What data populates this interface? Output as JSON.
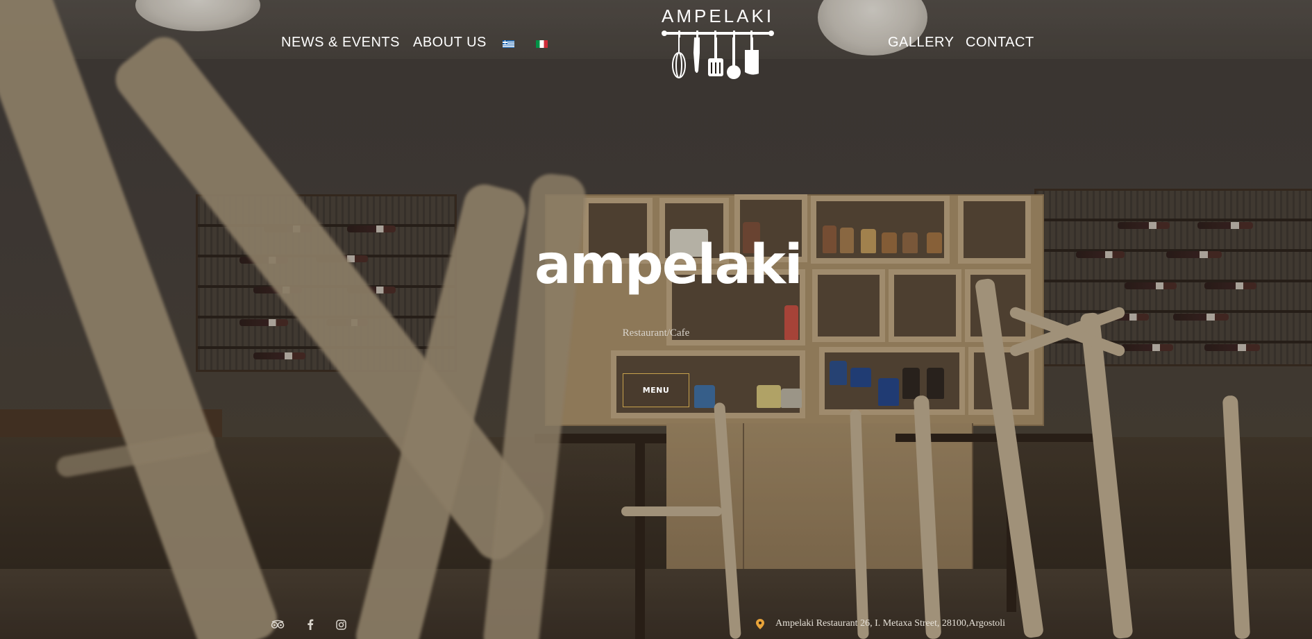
{
  "header": {
    "nav_left": [
      {
        "label": "NEWS & EVENTS"
      },
      {
        "label": "ABOUT US"
      }
    ],
    "languages": [
      {
        "code": "el",
        "icon": "greek-flag-icon"
      },
      {
        "code": "it",
        "icon": "italian-flag-icon"
      }
    ],
    "logo": {
      "text": "AMPELAKI",
      "icon": "kitchen-utensils-icon"
    },
    "nav_right": [
      {
        "label": "GALLERY"
      },
      {
        "label": "CONTACT"
      }
    ]
  },
  "hero": {
    "title": "ampelaki",
    "subtitle": "Restaurant/Cafe",
    "menu_button": "MENU"
  },
  "footer": {
    "social": [
      {
        "icon": "tripadvisor-icon"
      },
      {
        "icon": "facebook-icon"
      },
      {
        "icon": "instagram-icon"
      }
    ],
    "address_icon": "map-pin-icon",
    "address": "Ampelaki Restaurant 26, I. Metaxa Street, 28100,Argostoli"
  },
  "colors": {
    "accent": "#c8a24c",
    "pin": "#e8a33a",
    "text": "#ffffff"
  }
}
